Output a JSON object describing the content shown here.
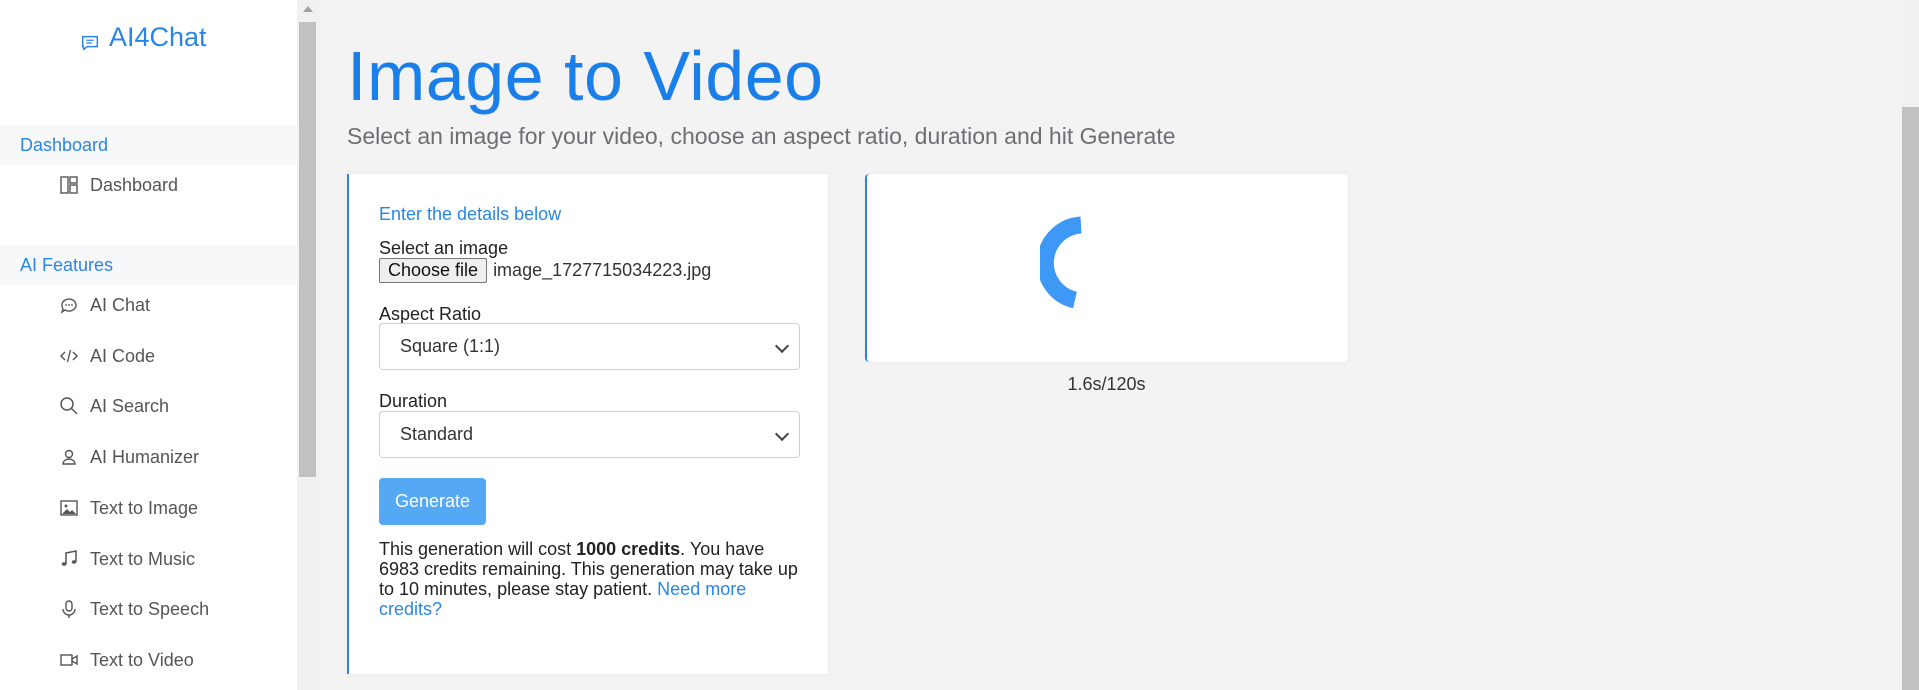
{
  "brand": {
    "name": "AI4Chat",
    "icon": "chat-bubble-icon"
  },
  "sidebar": {
    "sections": [
      {
        "header": "Dashboard",
        "items": [
          {
            "label": "Dashboard",
            "icon": "dashboard-icon"
          }
        ]
      },
      {
        "header": "AI Features",
        "items": [
          {
            "label": "AI Chat",
            "icon": "chat-icon"
          },
          {
            "label": "AI Code",
            "icon": "code-icon"
          },
          {
            "label": "AI Search",
            "icon": "search-icon"
          },
          {
            "label": "AI Humanizer",
            "icon": "user-icon"
          },
          {
            "label": "Text to Image",
            "icon": "image-icon"
          },
          {
            "label": "Text to Music",
            "icon": "music-icon"
          },
          {
            "label": "Text to Speech",
            "icon": "microphone-icon"
          },
          {
            "label": "Text to Video",
            "icon": "video-icon"
          }
        ]
      }
    ]
  },
  "page": {
    "title": "Image to Video",
    "subtitle": "Select an image for your video, choose an aspect ratio, duration and hit Generate"
  },
  "form": {
    "intro": "Enter the details below",
    "image_label": "Select an image",
    "file_button": "Choose file",
    "file_name": "image_1727715034223.jpg",
    "aspect_label": "Aspect Ratio",
    "aspect_value": "Square (1:1)",
    "duration_label": "Duration",
    "duration_value": "Standard",
    "generate_label": "Generate",
    "info_prefix": "This generation will cost ",
    "info_cost": "1000 credits",
    "info_suffix": ". You have 6983 credits remaining. This generation may take up to 10 minutes, please stay patient. ",
    "info_link": "Need more credits?"
  },
  "preview": {
    "timer": "1.6s/120s",
    "spinner_color": "#3d99f5"
  },
  "colors": {
    "accent": "#1a7fe8",
    "button": "#55a8f3"
  }
}
